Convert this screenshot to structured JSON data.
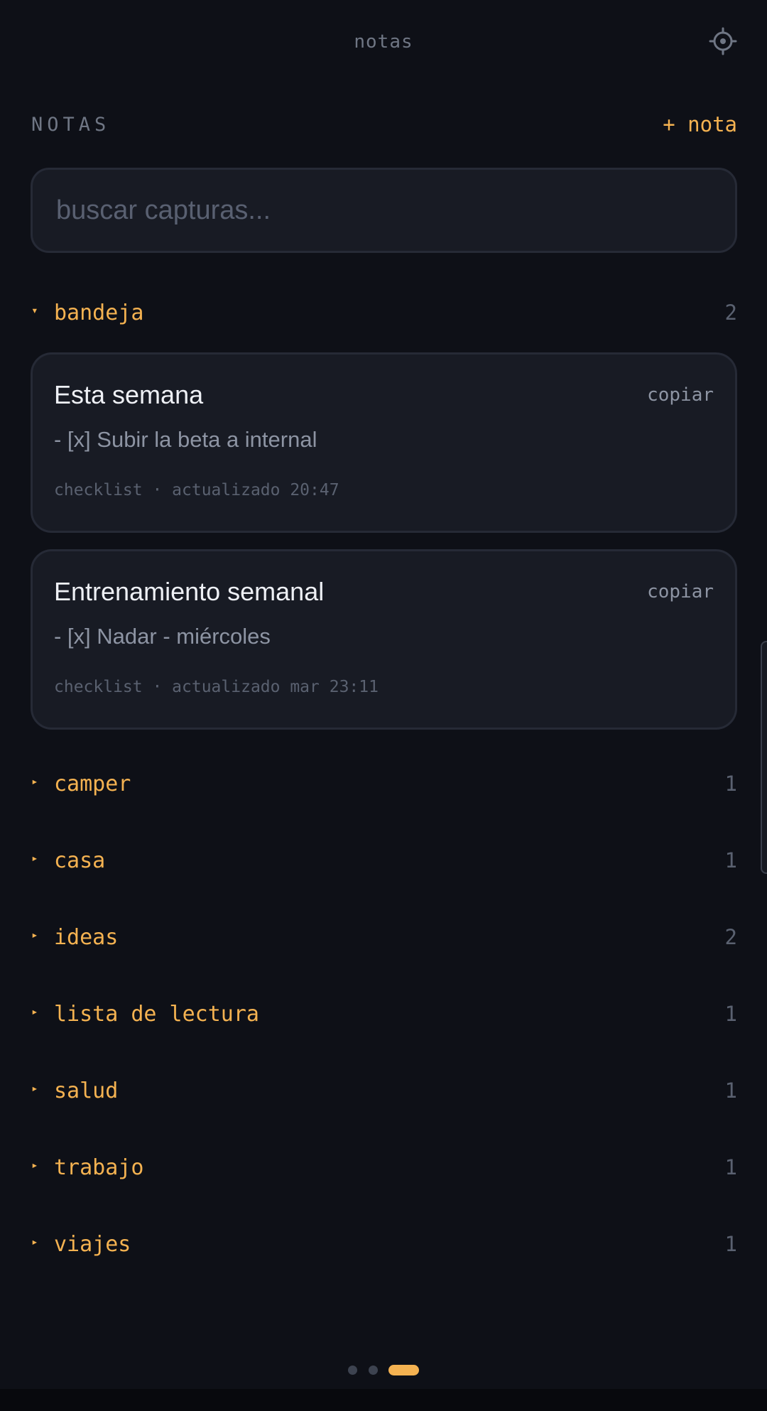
{
  "app_title": "notas",
  "section": {
    "title": "NOTAS",
    "new_note_label": "+ nota"
  },
  "search": {
    "placeholder": "buscar capturas...",
    "value": ""
  },
  "groups": [
    {
      "name": "bandeja",
      "count": "2",
      "caret": "▾",
      "expanded": true
    },
    {
      "name": "camper",
      "count": "1",
      "caret": "▸",
      "expanded": false
    },
    {
      "name": "casa",
      "count": "1",
      "caret": "▸",
      "expanded": false
    },
    {
      "name": "ideas",
      "count": "2",
      "caret": "▸",
      "expanded": false
    },
    {
      "name": "lista de lectura",
      "count": "1",
      "caret": "▸",
      "expanded": false
    },
    {
      "name": "salud",
      "count": "1",
      "caret": "▸",
      "expanded": false
    },
    {
      "name": "trabajo",
      "count": "1",
      "caret": "▸",
      "expanded": false
    },
    {
      "name": "viajes",
      "count": "1",
      "caret": "▸",
      "expanded": false
    }
  ],
  "notes": [
    {
      "title": "Esta semana",
      "copy_label": "copiar",
      "preview": "- [x] Subir la beta a internal",
      "meta": "checklist · actualizado 20:47"
    },
    {
      "title": "Entrenamiento semanal",
      "copy_label": "copiar",
      "preview": "- [x] Nadar - miércoles",
      "meta": "checklist · actualizado mar 23:11"
    }
  ],
  "pager": {
    "pages": 3,
    "current_page": 3
  },
  "colors": {
    "accent": "#f4b251",
    "background": "#0e1017",
    "card": "#181b24",
    "muted_text": "#6f7684"
  },
  "icons": {
    "settings": "gear-icon"
  }
}
